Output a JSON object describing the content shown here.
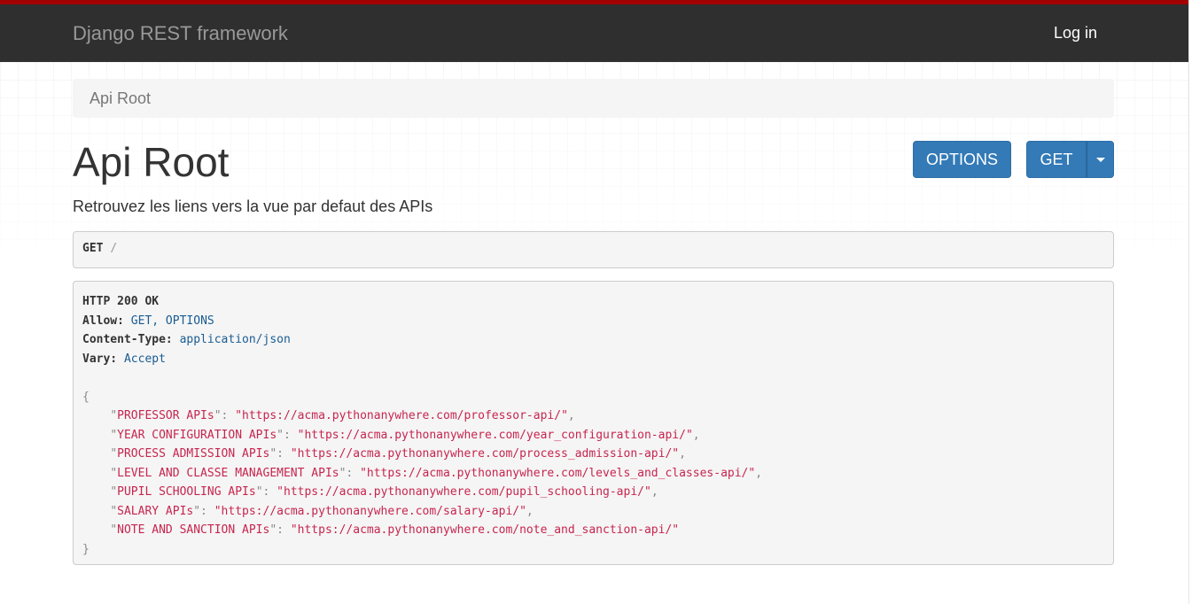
{
  "navbar": {
    "brand": "Django REST framework",
    "login_label": "Log in",
    "accent_color": "#a30000",
    "background_color": "#2f2f2f"
  },
  "breadcrumb": {
    "current": "Api Root"
  },
  "page": {
    "title": "Api Root",
    "description": "Retrouvez les liens vers la vue par defaut des APIs"
  },
  "buttons": {
    "options_label": "OPTIONS",
    "get_label": "GET",
    "primary_color": "#337ab7"
  },
  "request": {
    "method": "GET",
    "path": "/"
  },
  "response": {
    "status": "HTTP 200 OK",
    "headers": [
      {
        "name": "Allow:",
        "value": "GET, OPTIONS"
      },
      {
        "name": "Content-Type:",
        "value": "application/json"
      },
      {
        "name": "Vary:",
        "value": "Accept"
      }
    ],
    "body": [
      {
        "key": "PROFESSOR APIs",
        "url": "https://acma.pythonanywhere.com/professor-api/"
      },
      {
        "key": "YEAR CONFIGURATION APIs",
        "url": "https://acma.pythonanywhere.com/year_configuration-api/"
      },
      {
        "key": "PROCESS ADMISSION APIs",
        "url": "https://acma.pythonanywhere.com/process_admission-api/"
      },
      {
        "key": "LEVEL AND CLASSE MANAGEMENT APIs",
        "url": "https://acma.pythonanywhere.com/levels_and_classes-api/"
      },
      {
        "key": "PUPIL SCHOOLING APIs",
        "url": "https://acma.pythonanywhere.com/pupil_schooling-api/"
      },
      {
        "key": "SALARY APIs",
        "url": "https://acma.pythonanywhere.com/salary-api/"
      },
      {
        "key": "NOTE AND SANCTION APIs",
        "url": "https://acma.pythonanywhere.com/note_and_sanction-api/"
      }
    ]
  }
}
